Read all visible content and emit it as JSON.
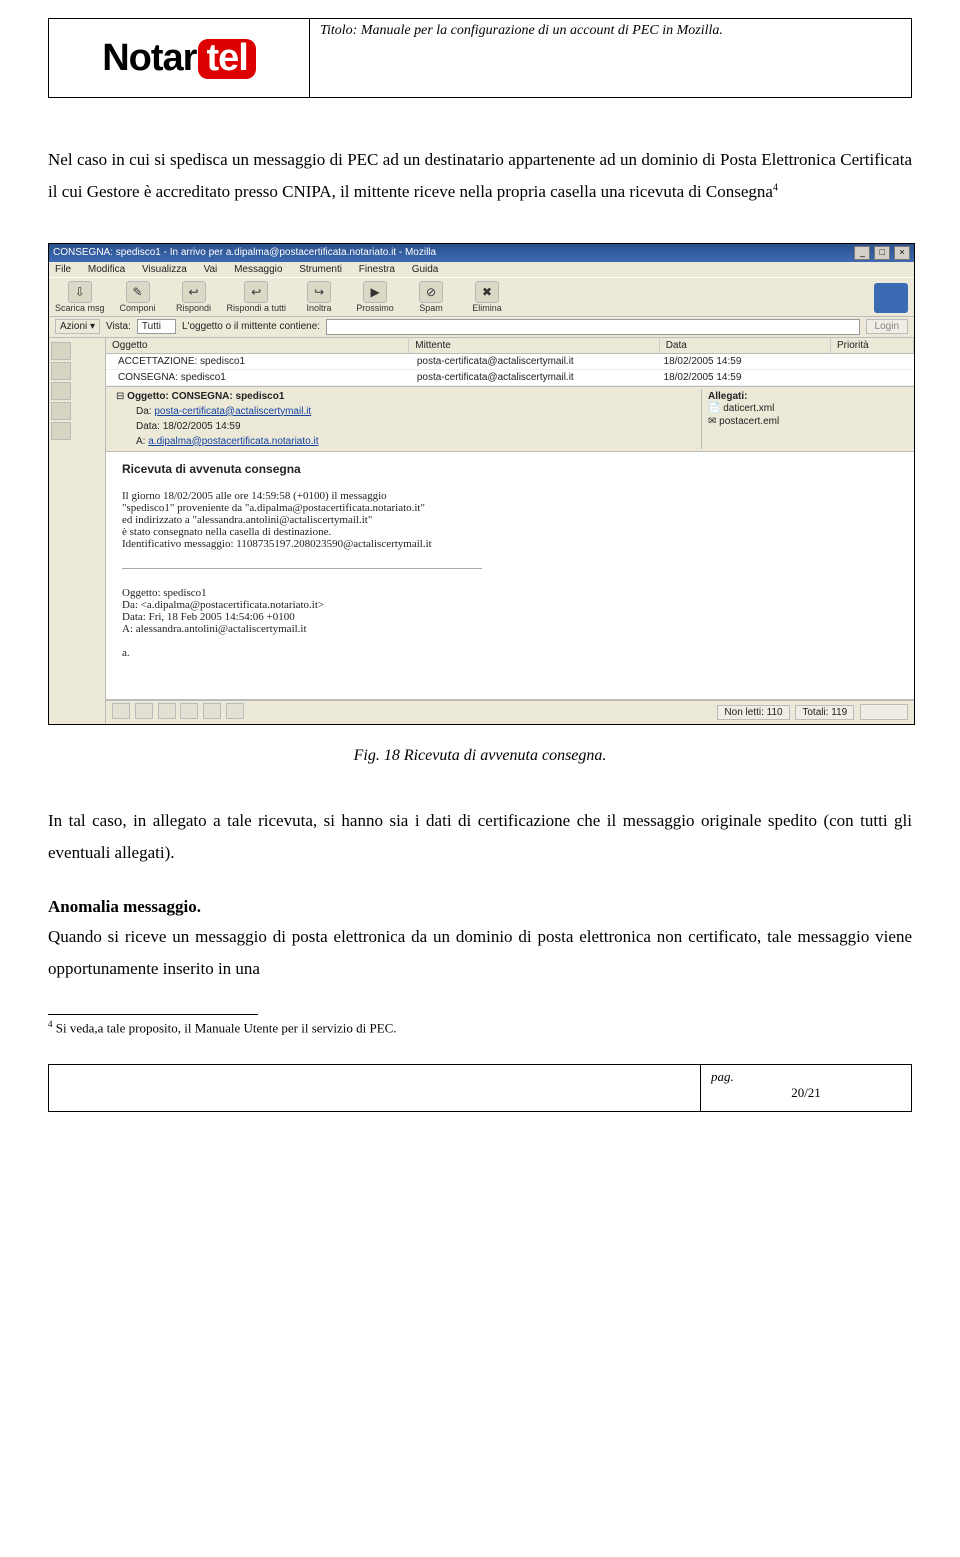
{
  "header": {
    "title_label": "Titolo:",
    "title_text": " Manuale per la configurazione di un account di PEC in Mozilla.",
    "logo_main": "Notar",
    "logo_accent": "tel"
  },
  "para1": "Nel caso in cui si spedisca un messaggio di PEC ad un destinatario appartenente ad un dominio di Posta Elettronica Certificata il cui Gestore è accreditato presso CNIPA, il mittente riceve nella propria casella una ricevuta di Consegna",
  "para1_sup": "4",
  "screenshot": {
    "window_title": "CONSEGNA: spedisco1 - In arrivo per a.dipalma@postacertificata.notariato.it - Mozilla",
    "menus": [
      "File",
      "Modifica",
      "Visualizza",
      "Vai",
      "Messaggio",
      "Strumenti",
      "Finestra",
      "Guida"
    ],
    "toolbar": [
      {
        "label": "Scarica msg",
        "icon": "⇩"
      },
      {
        "label": "Componi",
        "icon": "✎"
      },
      {
        "label": "Rispondi",
        "icon": "↩"
      },
      {
        "label": "Rispondi a tutti",
        "icon": "↩"
      },
      {
        "label": "Inoltra",
        "icon": "↪"
      },
      {
        "label": "Prossimo",
        "icon": "▶"
      },
      {
        "label": "Spam",
        "icon": "⊘"
      },
      {
        "label": "Elimina",
        "icon": "✖"
      }
    ],
    "search": {
      "vista_label": "Vista:",
      "vista_value": "Tutti",
      "filter_label": "L'oggetto o il mittente contiene:",
      "login_label": "Login"
    },
    "columns": {
      "oggetto": "Oggetto",
      "mittente": "Mittente",
      "data": "Data",
      "priorita": "Priorità"
    },
    "rows": [
      {
        "oggetto": "ACCETTAZIONE: spedisco1",
        "mittente": "posta-certificata@actaliscertymail.it",
        "data": "18/02/2005 14:59"
      },
      {
        "oggetto": "CONSEGNA: spedisco1",
        "mittente": "posta-certificata@actaliscertymail.it",
        "data": "18/02/2005 14:59"
      }
    ],
    "msg_header": {
      "oggetto_label": "Oggetto:",
      "oggetto_value": "CONSEGNA: spedisco1",
      "da_label": "Da:",
      "da_value": "posta-certificata@actaliscertymail.it",
      "data_label": "Data:",
      "data_value": "18/02/2005 14:59",
      "a_label": "A:",
      "a_value": "a.dipalma@postacertificata.notariato.it",
      "allegati_label": "Allegati:",
      "allegati": [
        "daticert.xml",
        "postacert.eml"
      ]
    },
    "msg_body": {
      "heading": "Ricevuta di avvenuta consegna",
      "p1": "Il giorno 18/02/2005 alle ore 14:59:58 (+0100) il messaggio",
      "p2": "\"spedisco1\" proveniente da \"a.dipalma@postacertificata.notariato.it\"",
      "p3": "ed indirizzato a \"alessandra.antolini@actaliscertymail.it\"",
      "p4": "è stato consegnato nella casella di destinazione.",
      "p5": "Identificativo messaggio: 1108735197.208023590@actaliscertymail.it",
      "q1": "Oggetto: spedisco1",
      "q2": "Da: <a.dipalma@postacertificata.notariato.it>",
      "q3": "Data: Fri, 18 Feb 2005 14:54:06 +0100",
      "q4": "A: alessandra.antolini@actaliscertymail.it",
      "q5": "a."
    },
    "status": {
      "unread": "Non letti: 110",
      "total": "Totali: 119"
    }
  },
  "caption": "Fig. 18 Ricevuta di avvenuta consegna.",
  "para2": "In tal caso, in allegato a tale ricevuta, si hanno sia i dati di certificazione che il messaggio originale spedito (con tutti gli eventuali allegati).",
  "section_heading": "Anomalia messaggio.",
  "para3": "Quando si riceve un messaggio di posta elettronica da un dominio di posta elettronica non certificato, tale messaggio viene opportunamente inserito in una",
  "footnote": {
    "num": "4",
    "text": " Si veda,a tale proposito, il Manuale Utente per il servizio di PEC."
  },
  "footer": {
    "pag_label": "pag.",
    "page_num": "20/21"
  }
}
